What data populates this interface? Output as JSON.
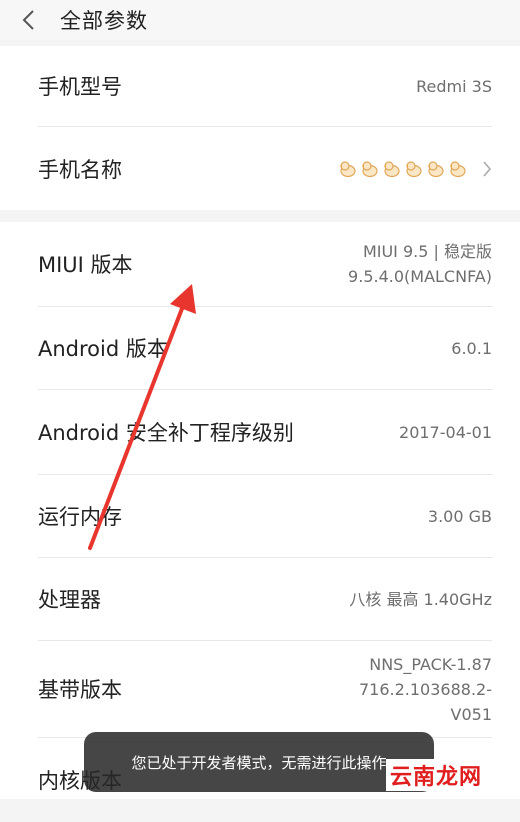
{
  "header": {
    "title": "全部参数"
  },
  "rows": [
    {
      "label": "手机型号",
      "value": "Redmi 3S"
    },
    {
      "label": "手机名称",
      "value": ""
    },
    {
      "label": "MIUI 版本",
      "value_line1": "MIUI 9.5 | 稳定版",
      "value_line2": "9.5.4.0(MALCNFA)"
    },
    {
      "label": "Android 版本",
      "value": "6.0.1"
    },
    {
      "label": "Android 安全补丁程序级别",
      "value": "2017-04-01"
    },
    {
      "label": "运行内存",
      "value": "3.00 GB"
    },
    {
      "label": "处理器",
      "value": "八核 最高 1.40GHz"
    },
    {
      "label": "基带版本",
      "value_line1": "NNS_PACK-1.87",
      "value_line2": "716.2.103688.2-",
      "value_line3": "V051"
    },
    {
      "label": "内核版本",
      "value": ""
    }
  ],
  "toast": {
    "text": "您已处于开发者模式，无需进行此操作"
  },
  "watermark": {
    "text": "云南龙网"
  },
  "icons": {
    "back": "back-chevron-icon",
    "forward": "chevron-right-icon",
    "emoji": "duck-emoji-icon"
  },
  "colors": {
    "annotation_arrow": "#e8352e",
    "watermark": "#e01e1e"
  }
}
